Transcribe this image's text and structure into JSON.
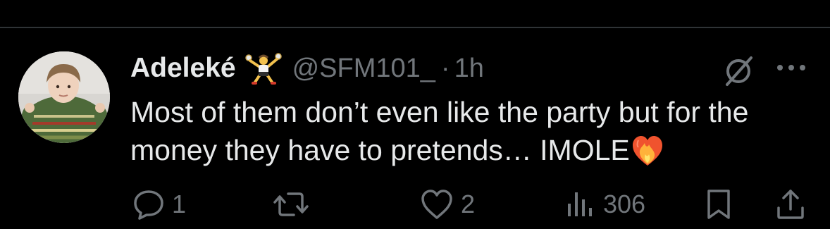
{
  "tweet": {
    "author_name": "Adeleké",
    "badge_emoji": "person-juggling-emoji",
    "handle": "@SFM101_",
    "separator": "·",
    "time": "1h",
    "text": "Most of them don’t even like the party but for the money they have to pretends… IMOLE",
    "trailing_emoji": "heart-on-fire-emoji"
  },
  "actions": {
    "replies": "1",
    "reposts": "",
    "likes": "2",
    "views": "306"
  },
  "colors": {
    "background": "#000000",
    "text_primary": "#e7e9ea",
    "text_secondary": "#71767b",
    "divider": "#2f3336"
  }
}
